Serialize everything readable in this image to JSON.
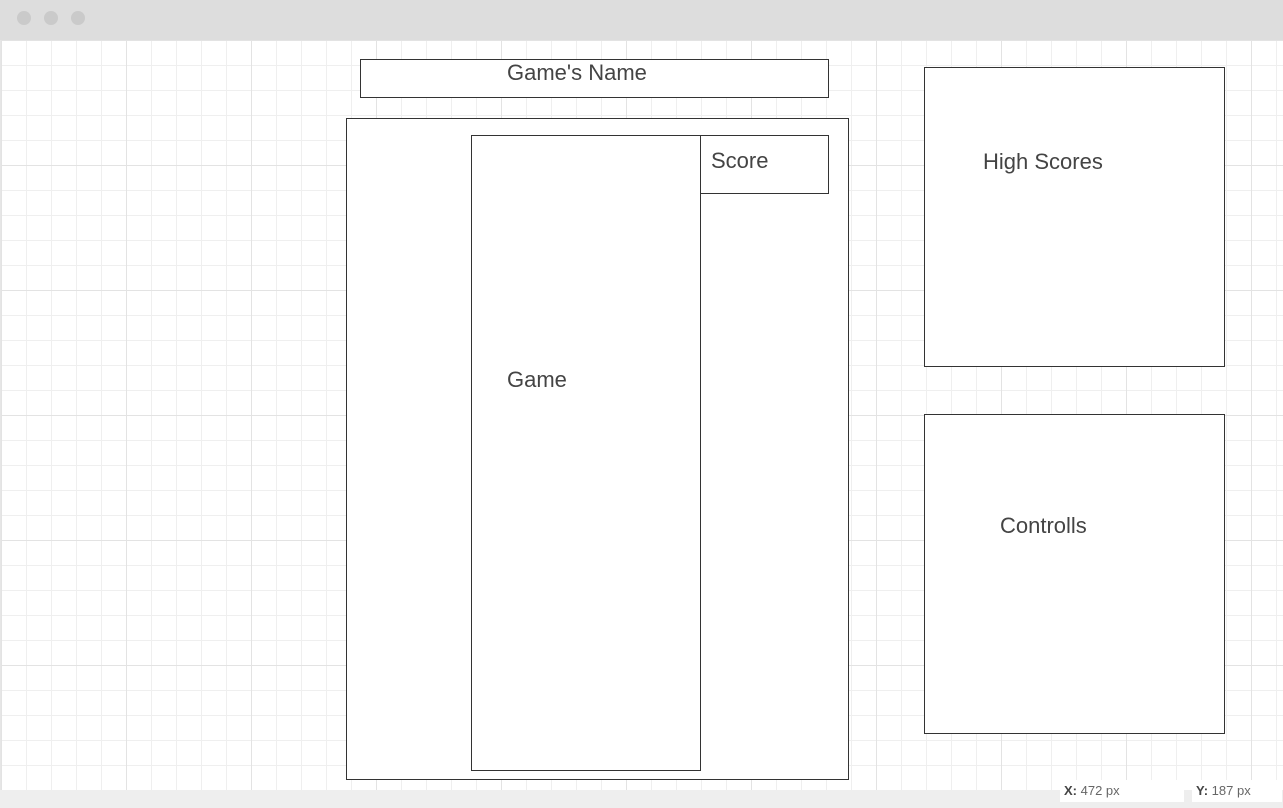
{
  "window": {
    "controls": [
      "close",
      "minimize",
      "maximize"
    ]
  },
  "wireframe": {
    "title_label": "Game's Name",
    "score_label": "Score",
    "game_label": "Game",
    "high_scores_label": "High Scores",
    "controls_label": "Controlls"
  },
  "status": {
    "x_label": "X:",
    "x_value": "472 px",
    "y_label": "Y:",
    "y_value": "187 px"
  }
}
